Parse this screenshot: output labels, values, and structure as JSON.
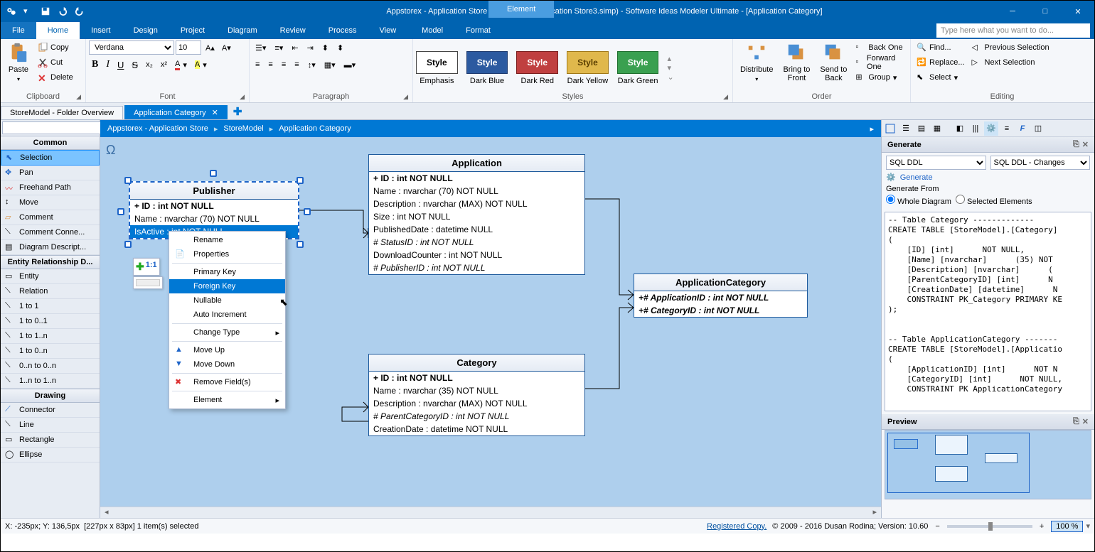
{
  "titlebar": {
    "context_tab": "Element",
    "title": "Appstorex - Application Store (Appstorex - Application Store3.simp)  - Software Ideas Modeler Ultimate - [Application Category]"
  },
  "menubar": {
    "items": [
      "File",
      "Home",
      "Insert",
      "Design",
      "Project",
      "Diagram",
      "Review",
      "Process",
      "View",
      "Model",
      "Format"
    ],
    "active": "Home",
    "searchPlaceholder": "Type here what you want to do..."
  },
  "ribbon": {
    "clipboard": {
      "paste": "Paste",
      "copy": "Copy",
      "cut": "Cut",
      "delete": "Delete",
      "label": "Clipboard"
    },
    "font": {
      "family": "Verdana",
      "size": "10",
      "label": "Font"
    },
    "paragraph": {
      "label": "Paragraph"
    },
    "styles": {
      "label": "Styles",
      "emphasis": "Emphasis",
      "darkblue": "Dark Blue",
      "darkred": "Dark Red",
      "darkyellow": "Dark Yellow",
      "darkgreen": "Dark Green",
      "btn": "Style"
    },
    "order": {
      "distribute": "Distribute",
      "bringfront": "Bring to\nFront",
      "sendback": "Send to\nBack",
      "backone": "Back One",
      "forwardone": "Forward One",
      "group": "Group",
      "label": "Order"
    },
    "editing": {
      "find": "Find...",
      "replace": "Replace...",
      "select": "Select",
      "prevsel": "Previous Selection",
      "nextsel": "Next Selection",
      "label": "Editing"
    }
  },
  "doctabs": {
    "t1": "StoreModel - Folder Overview",
    "t2": "Application Category"
  },
  "breadcrumb": {
    "a": "Appstorex - Application Store",
    "b": "StoreModel",
    "c": "Application Category"
  },
  "toolbox": {
    "common": "Common",
    "tools": [
      "Selection",
      "Pan",
      "Freehand Path",
      "Move",
      "Comment",
      "Comment Conne...",
      "Diagram Descript..."
    ],
    "erd": "Entity Relationship D...",
    "erdtools": [
      "Entity",
      "Relation",
      "1 to 1",
      "1 to 0..1",
      "1 to 1..n",
      "1 to 0..n",
      "0..n to 0..n",
      "1..n to 1..n"
    ],
    "drawing": "Drawing",
    "drawtools": [
      "Connector",
      "Line",
      "Rectangle",
      "Ellipse"
    ]
  },
  "canvas": {
    "publisher": {
      "name": "Publisher",
      "rows": [
        "+ ID : int NOT NULL",
        "Name : nvarchar (70)  NOT NULL",
        "IsActive : int NOT NULL"
      ]
    },
    "application": {
      "name": "Application",
      "rows": [
        "+ ID : int NOT NULL",
        "Name : nvarchar (70)  NOT NULL",
        "Description : nvarchar (MAX)  NOT NULL",
        "Size : int NOT NULL",
        "PublishedDate : datetime NULL",
        "# StatusID : int NOT NULL",
        "DownloadCounter : int NOT NULL",
        "# PublisherID : int NOT NULL"
      ]
    },
    "category": {
      "name": "Category",
      "rows": [
        "+ ID : int NOT NULL",
        "Name : nvarchar (35)  NOT NULL",
        "Description : nvarchar (MAX)  NOT NULL",
        "# ParentCategoryID : int NOT NULL",
        "CreationDate : datetime NOT NULL"
      ]
    },
    "appcat": {
      "name": "ApplicationCategory",
      "rows": [
        "+# ApplicationID : int NOT NULL",
        "+# CategoryID : int NOT NULL"
      ]
    },
    "cardinality": "1:1"
  },
  "contextmenu": {
    "rename": "Rename",
    "properties": "Properties",
    "primarykey": "Primary Key",
    "foreignkey": "Foreign Key",
    "nullable": "Nullable",
    "autoinc": "Auto Increment",
    "changetype": "Change Type",
    "moveup": "Move Up",
    "movedown": "Move Down",
    "removefields": "Remove Field(s)",
    "element": "Element"
  },
  "rightpanel": {
    "generate": {
      "title": "Generate",
      "ddl": "SQL DDL",
      "ddlchanges": "SQL DDL - Changes",
      "gen": "Generate",
      "genfrom": "Generate From",
      "whole": "Whole Diagram",
      "selected": "Selected Elements"
    },
    "code": "-- Table Category -------------\nCREATE TABLE [StoreModel].[Category]\n(\n    [ID] [int]      NOT NULL,\n    [Name] [nvarchar]      (35) NOT \n    [Description] [nvarchar]      (\n    [ParentCategoryID] [int]      N\n    [CreationDate] [datetime]      N\n    CONSTRAINT PK_Category PRIMARY KE\n);\n\n\n-- Table ApplicationCategory -------\nCREATE TABLE [StoreModel].[Applicatio\n(\n    [ApplicationID] [int]      NOT N\n    [CategoryID] [int]      NOT NULL,\n    CONSTRAINT PK ApplicationCategory",
    "preview": "Preview"
  },
  "statusbar": {
    "coords": "X: -235px; Y: 136,5px",
    "sel": "[227px x 83px] 1 item(s) selected",
    "registered": "Registered Copy.",
    "copyright": "© 2009 - 2016 Dusan Rodina; Version: 10.60",
    "zoom": "100 %"
  }
}
